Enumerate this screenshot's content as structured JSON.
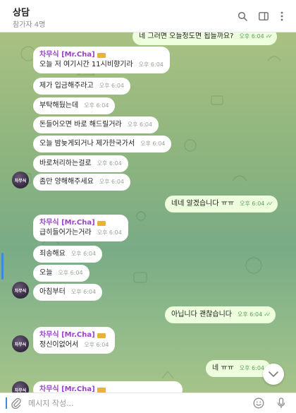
{
  "header": {
    "title": "상담",
    "subtitle": "참가자 4명"
  },
  "composer": {
    "placeholder": "메시지 작성..."
  },
  "sender": {
    "name": "차무식 [Mr.Cha]",
    "avatar_text": "차무식"
  },
  "messages": {
    "top_out": {
      "text": "네 그러면 오들정도면 됩들까요?",
      "time": "오후 6:04"
    },
    "m1": {
      "text": "오늘 저 여기시간 11시비향기라",
      "time": "오후 6:04"
    },
    "m2": {
      "text": "제가 입금해주라고",
      "time": "오후 6:04"
    },
    "m3": {
      "text": "부탁해뒀는데",
      "time": "오후 6:04"
    },
    "m4": {
      "text": "돈들어오면 바로 해드릴거라",
      "time": "오후 6:04"
    },
    "m5": {
      "text": "오늘 밤늦게되거나 제가한국가서",
      "time": "오후 6:04"
    },
    "m6": {
      "text": "바로처리하는걸로",
      "time": "오후 6:04"
    },
    "m7": {
      "text": "좀만 양해해주세요",
      "time": "오후 6:04"
    },
    "o1": {
      "text": "네네 알겠습니다 ㅠㅠ",
      "time": "오후 6:04"
    },
    "m8": {
      "text": "급히들어가는거라",
      "time": "오후 6:04"
    },
    "m9": {
      "text": "죄송해요",
      "time": "오후 6:04"
    },
    "m10": {
      "text": "오늘",
      "time": "오후 6:04"
    },
    "m11": {
      "text": "아침부터",
      "time": "오후 6:04"
    },
    "o2": {
      "text": "아닙니다 괜찮습니다",
      "time": "오후 6:04"
    },
    "m12": {
      "text": "정신이없어서",
      "time": "오후 6:04"
    },
    "o3": {
      "text": "네 ㅠㅠ",
      "time": "오후 6:04"
    }
  },
  "colors": {
    "incoming_bubble": "#ffffff",
    "outgoing_bubble": "#eeffde",
    "sender_name": "#9a3fcf",
    "accent": "#3d8bd8"
  }
}
